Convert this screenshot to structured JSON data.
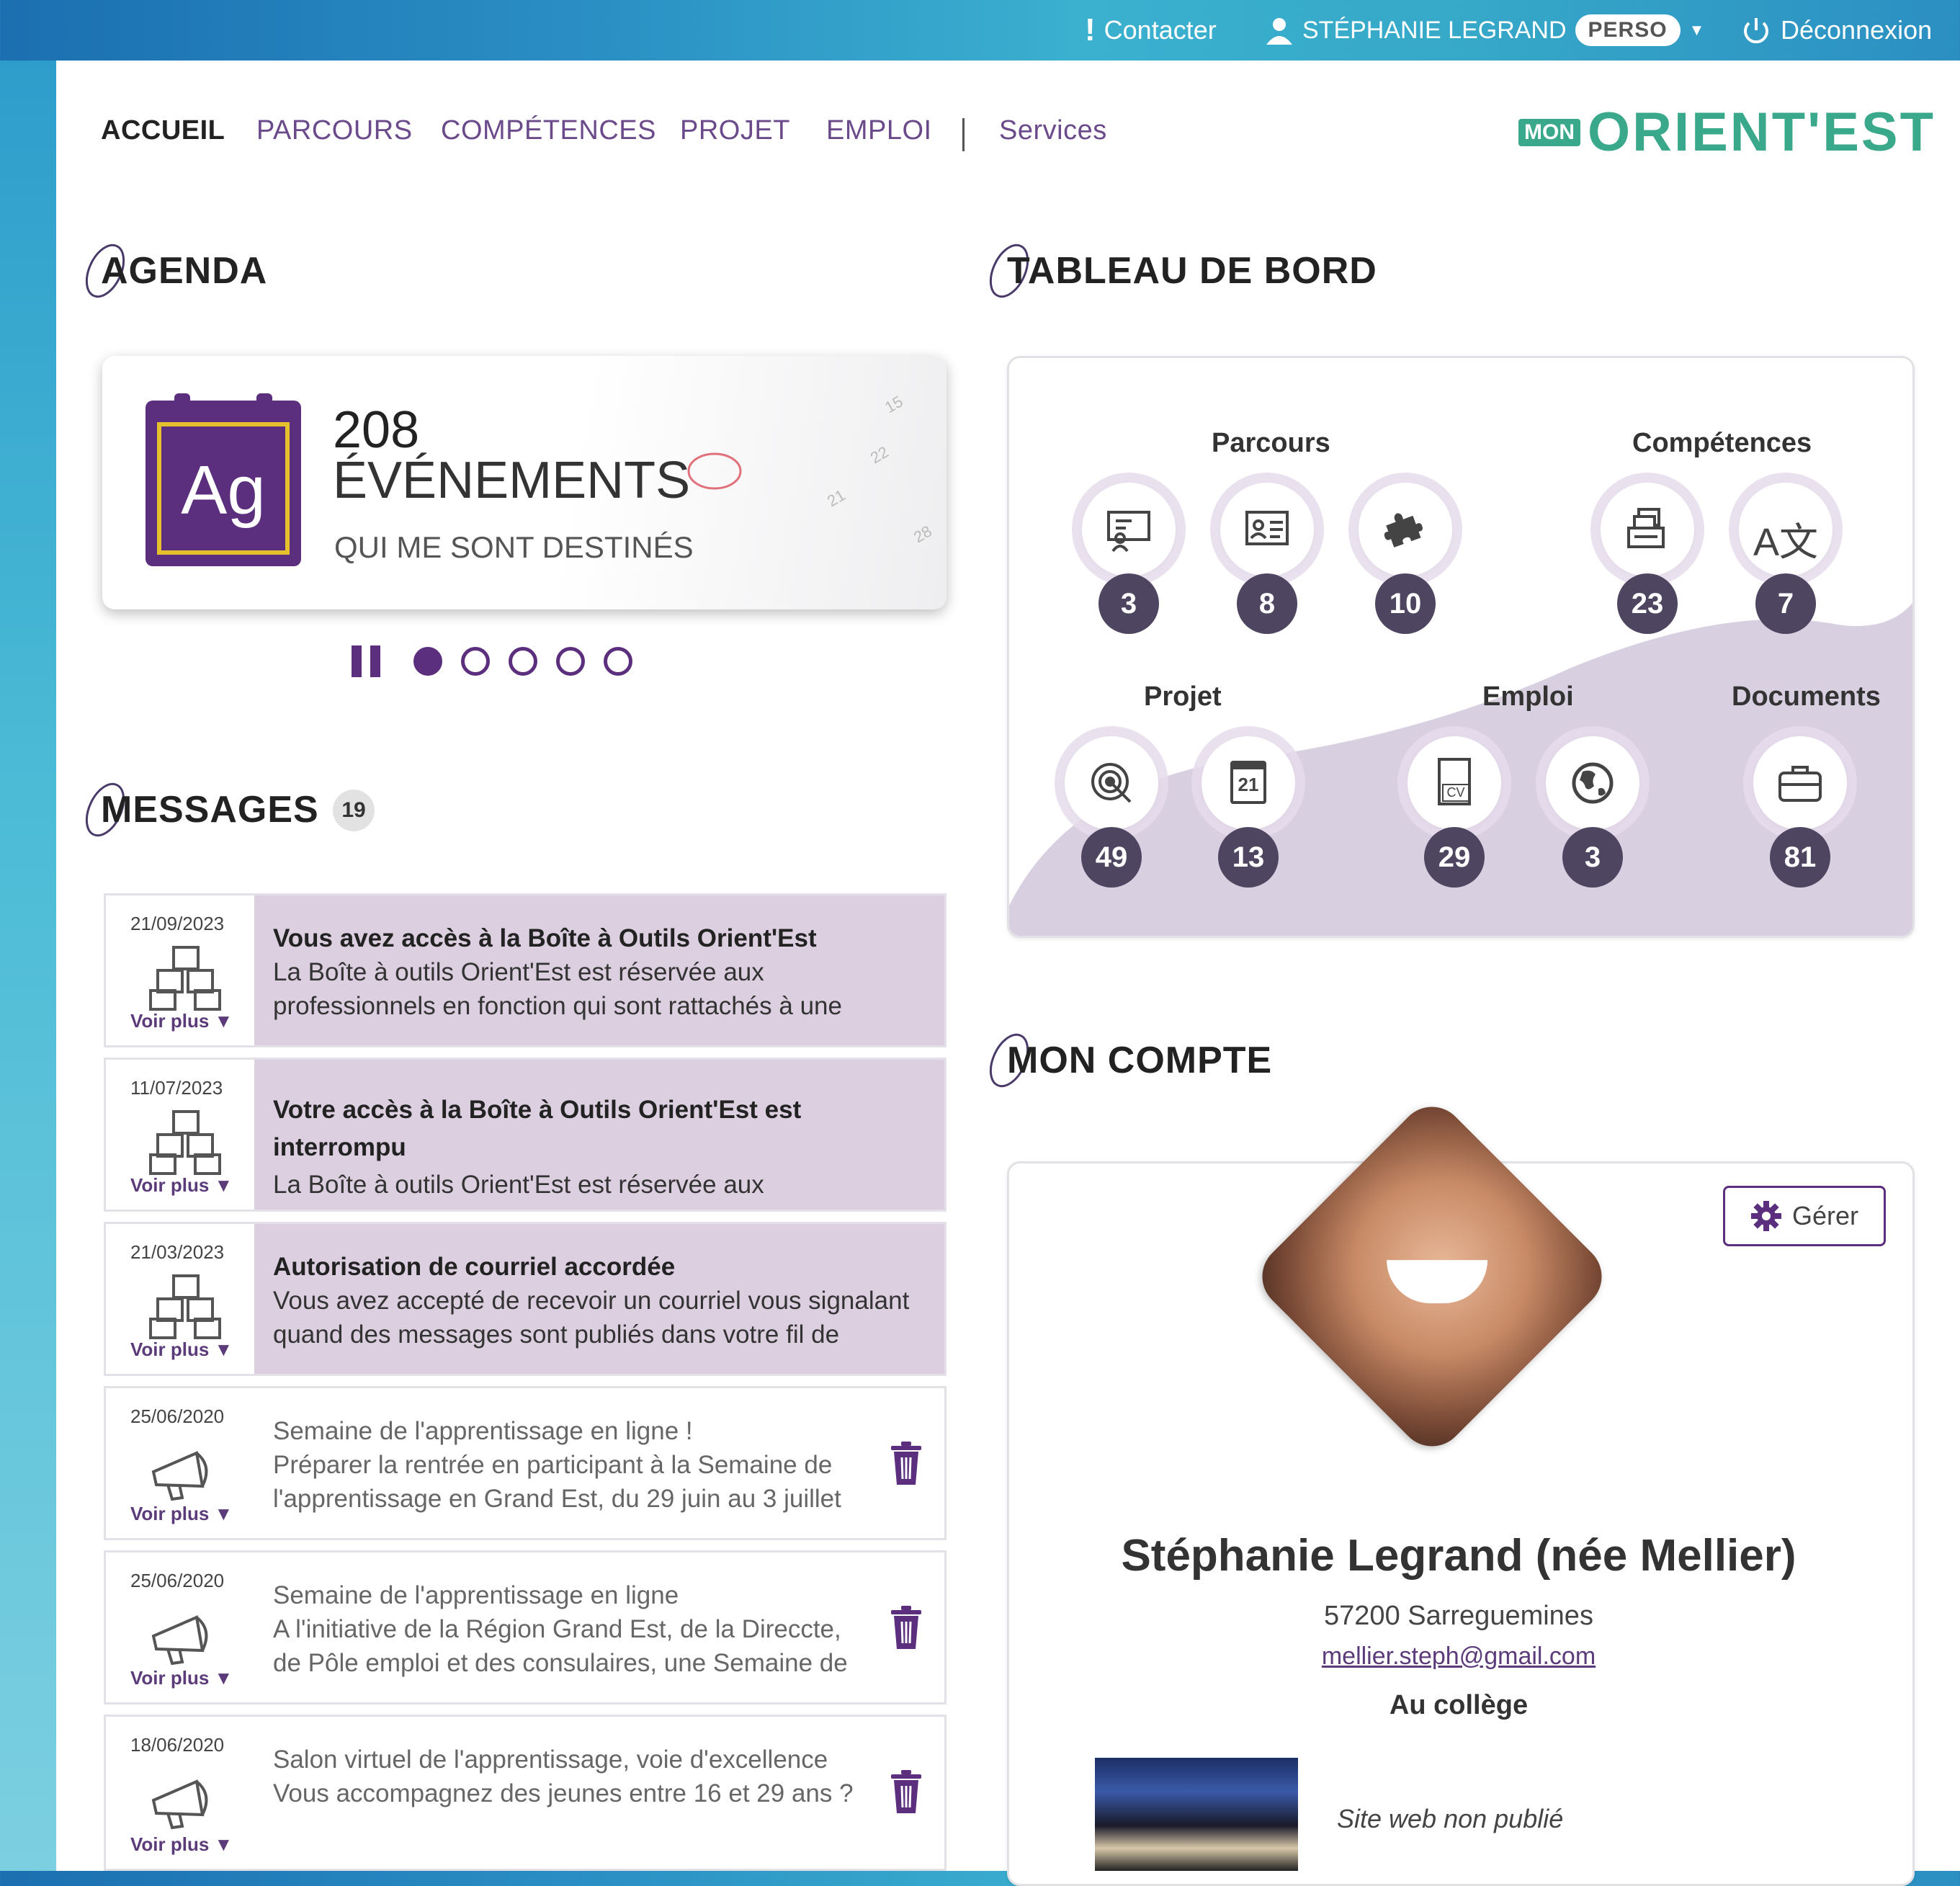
{
  "topbar": {
    "contact": "Contacter",
    "user_name": "STÉPHANIE LEGRAND",
    "profile_badge": "PERSO",
    "logout": "Déconnexion"
  },
  "nav": {
    "items": [
      "ACCUEIL",
      "PARCOURS",
      "COMPÉTENCES",
      "PROJET",
      "EMPLOI"
    ],
    "services": "Services",
    "active": "ACCUEIL"
  },
  "logo": {
    "prefix": "MON",
    "name": "ORIENT'EST"
  },
  "agenda": {
    "title": "AGENDA",
    "app_icon": "Ag",
    "count": "208",
    "label": "ÉVÉNEMENTS",
    "sublabel": "QUI ME SONT DESTINÉS",
    "carousel_dots": 5,
    "active_dot": 0
  },
  "messages": {
    "title": "MESSAGES",
    "count": "19",
    "voir_plus": "Voir plus",
    "items": [
      {
        "date": "21/09/2023",
        "icon": "cubes-icon",
        "unread": true,
        "title": "Vous avez accès à la Boîte à Outils Orient'Est",
        "lines": [
          "La Boîte à outils Orient'Est est réservée aux",
          "professionnels en fonction qui sont rattachés à une"
        ]
      },
      {
        "date": "11/07/2023",
        "icon": "cubes-icon",
        "unread": true,
        "title": "Votre accès à la Boîte à Outils Orient'Est est",
        "title2": "interrompu",
        "lines": [
          "La Boîte à outils Orient'Est est réservée aux"
        ]
      },
      {
        "date": "21/03/2023",
        "icon": "cubes-icon",
        "unread": true,
        "title": "Autorisation de courriel accordée",
        "lines": [
          "Vous avez accepté de recevoir un courriel vous signalant",
          "quand des messages sont publiés dans votre fil de"
        ]
      },
      {
        "date": "25/06/2020",
        "icon": "megaphone-icon",
        "unread": false,
        "title": "Semaine de l'apprentissage en ligne !",
        "lines": [
          "Préparer la rentrée en participant à la Semaine de",
          "l'apprentissage en Grand Est, du 29 juin au 3 juillet"
        ]
      },
      {
        "date": "25/06/2020",
        "icon": "megaphone-icon",
        "unread": false,
        "title": "Semaine de l'apprentissage en ligne",
        "lines": [
          "A l'initiative de la Région Grand Est, de la Direccte,",
          "de Pôle emploi et des consulaires, une Semaine de"
        ]
      },
      {
        "date": "18/06/2020",
        "icon": "megaphone-icon",
        "unread": false,
        "title": "Salon virtuel de l'apprentissage, voie d'excellence",
        "lines": [
          "Vous accompagnez des jeunes entre 16 et 29 ans ?"
        ]
      }
    ]
  },
  "dashboard": {
    "title": "TABLEAU DE BORD",
    "groups": {
      "parcours": "Parcours",
      "competences": "Compétences",
      "projet": "Projet",
      "emploi": "Emploi",
      "documents": "Documents"
    },
    "counters": [
      {
        "icon": "presentation-icon",
        "value": "3"
      },
      {
        "icon": "id-card-icon",
        "value": "8"
      },
      {
        "icon": "puzzle-icon",
        "value": "10"
      },
      {
        "icon": "stack-icon",
        "value": "23"
      },
      {
        "icon": "language-icon",
        "value": "7",
        "glyph": "A文"
      },
      {
        "icon": "target-icon",
        "value": "49"
      },
      {
        "icon": "calendar-icon",
        "value": "13",
        "glyph": "21"
      },
      {
        "icon": "cv-icon",
        "value": "29",
        "glyph": "CV"
      },
      {
        "icon": "globe-icon",
        "value": "3"
      },
      {
        "icon": "briefcase-icon",
        "value": "81"
      }
    ]
  },
  "account": {
    "title": "MON COMPTE",
    "manage_button": "Gérer",
    "name": "Stéphanie Legrand (née Mellier)",
    "location": "57200 Sarreguemines",
    "email": "mellier.steph@gmail.com",
    "status": "Au collège",
    "website": "Site web non publié"
  },
  "colors": {
    "brand_purple": "#5b2f7e",
    "unread_bg": "#dccfe0",
    "counter_bg": "#4e4660",
    "logo_green": "#3aa88a"
  }
}
